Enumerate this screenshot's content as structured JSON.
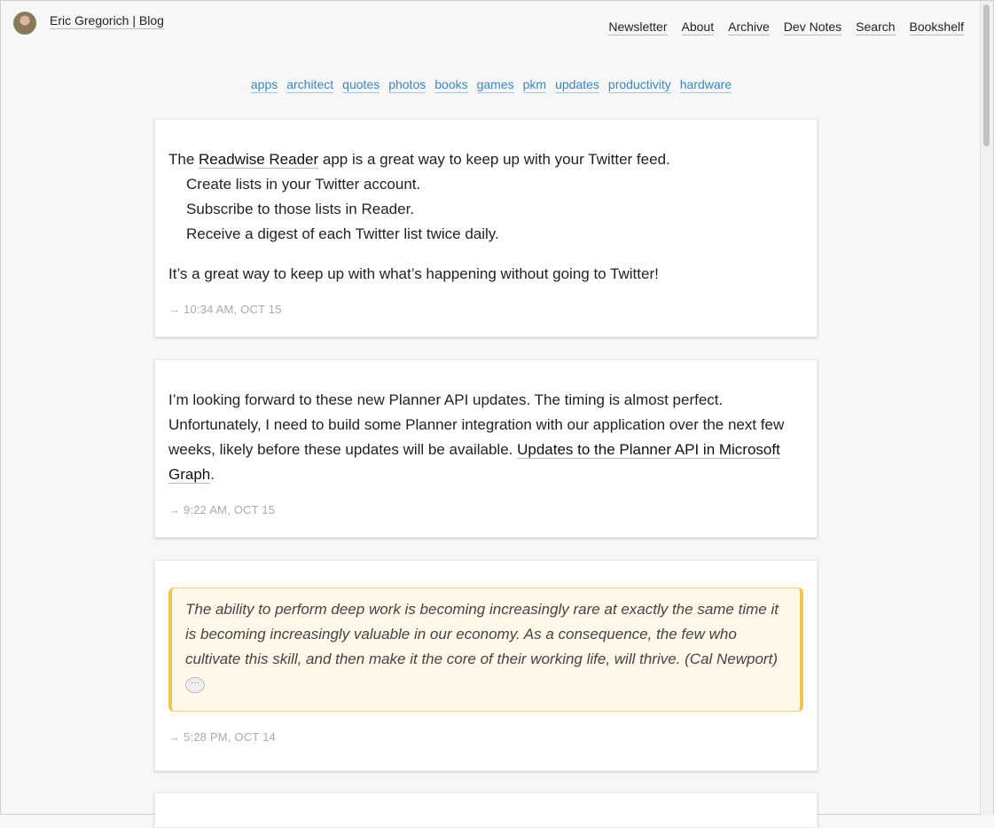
{
  "site": {
    "title": "Eric Gregorich | Blog"
  },
  "nav": [
    "Newsletter",
    "About",
    "Archive",
    "Dev Notes",
    "Search",
    "Bookshelf"
  ],
  "tags": [
    "apps",
    "architect",
    "quotes",
    "photos",
    "books",
    "games",
    "pkm",
    "updates",
    "productivity",
    "hardware"
  ],
  "posts": [
    {
      "intro_before": "The ",
      "intro_link": "Readwise Reader",
      "intro_after": " app is a great way to keep up with your Twitter feed.",
      "steps": [
        "Create lists in your Twitter account.",
        "Subscribe to those lists in Reader.",
        "Receive a digest of each Twitter list twice daily."
      ],
      "closing": "It’s a great way to keep up with what’s happening without going to Twitter!",
      "timestamp": "→ 10:34 AM, OCT 15"
    },
    {
      "text_before": "I’m looking forward to these new Planner API updates. The timing is almost perfect. Unfortunately, I need to build some Planner integration with our application over the next few weeks, likely before these updates will be available. ",
      "link": "Updates to the Planner API in Microsoft Graph",
      "text_after": ".",
      "timestamp": "→ 9:22 AM, OCT 15"
    },
    {
      "quote": "The ability to perform deep work is becoming increasingly rare at exactly the same time it is becoming increasingly valuable in our economy. As a consequence, the few who cultivate this skill, and then make it the core of their working life, will thrive. (Cal Newport)",
      "timestamp": "→ 5:28 PM, OCT 14"
    }
  ],
  "icons": {
    "avatar": "author-avatar",
    "comment": "speech-bubble-icon"
  },
  "colors": {
    "tag_link": "#3a86c8",
    "quote_bg": "#fff7e8",
    "quote_border": "#f2c450",
    "page_bg": "#f7f7f7"
  }
}
